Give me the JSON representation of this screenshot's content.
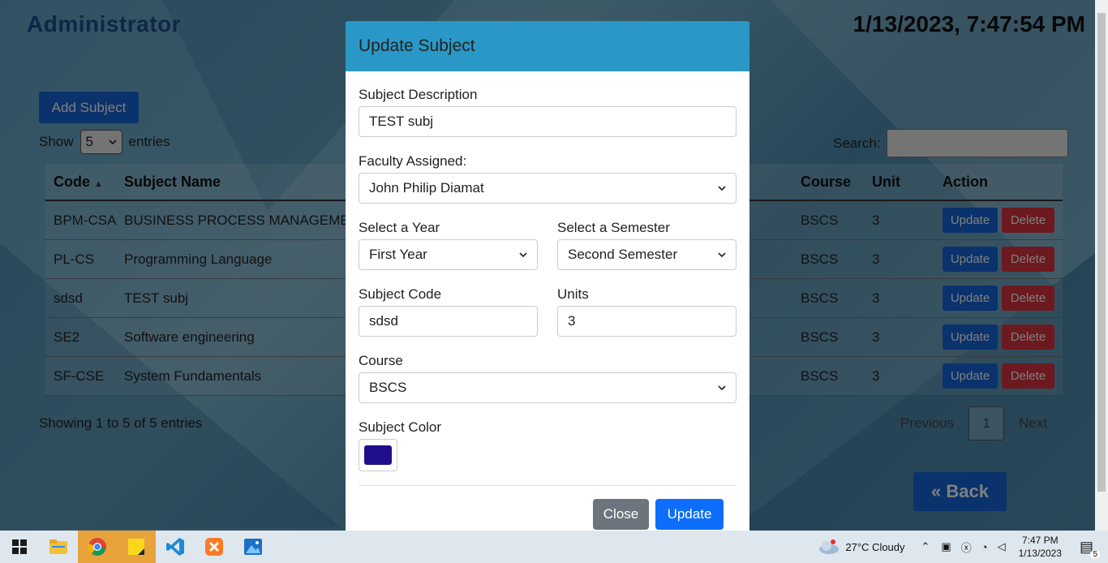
{
  "header": {
    "title": "Administrator",
    "datetime": "1/13/2023, 7:47:54 PM"
  },
  "toolbar": {
    "add_label": "Add Subject"
  },
  "length": {
    "show": "Show",
    "value": "5",
    "entries": "entries"
  },
  "search": {
    "label": "Search:"
  },
  "table": {
    "headers": {
      "code": "Code",
      "name": "Subject Name",
      "course": "Course",
      "unit": "Unit",
      "action": "Action"
    },
    "rows": [
      {
        "code": "BPM-CSA",
        "name": "BUSINESS PROCESS MANAGEMEN",
        "course": "BSCS",
        "unit": "3"
      },
      {
        "code": "PL-CS",
        "name": "Programming Language",
        "course": "BSCS",
        "unit": "3"
      },
      {
        "code": "sdsd",
        "name": "TEST subj",
        "course": "BSCS",
        "unit": "3"
      },
      {
        "code": "SE2",
        "name": "Software engineering",
        "course": "BSCS",
        "unit": "3"
      },
      {
        "code": "SF-CSE",
        "name": "System Fundamentals",
        "course": "BSCS",
        "unit": "3"
      }
    ],
    "update_label": "Update",
    "delete_label": "Delete"
  },
  "footer": {
    "showing": "Showing 1 to 5 of 5 entries",
    "previous": "Previous",
    "page": "1",
    "next": "Next"
  },
  "back_label": "Back",
  "modal": {
    "title": "Update Subject",
    "desc_label": "Subject Description",
    "desc_value": "TEST subj",
    "faculty_label": "Faculty Assigned:",
    "faculty_value": "John Philip Diamat",
    "year_label": "Select a Year",
    "year_value": "First Year",
    "sem_label": "Select a Semester",
    "sem_value": "Second Semester",
    "code_label": "Subject Code",
    "code_value": "sdsd",
    "units_label": "Units",
    "units_value": "3",
    "course_label": "Course",
    "course_value": "BSCS",
    "color_label": "Subject Color",
    "color_value": "#1f0f8c",
    "close_label": "Close",
    "update_label": "Update"
  },
  "taskbar": {
    "weather": "27°C  Cloudy",
    "time": "7:47 PM",
    "date": "1/13/2023",
    "notif_count": "5"
  },
  "colors": {
    "primary": "#1565d8",
    "danger": "#d8323f",
    "modal_header": "#2a98c6",
    "secondary": "#6c757d"
  }
}
